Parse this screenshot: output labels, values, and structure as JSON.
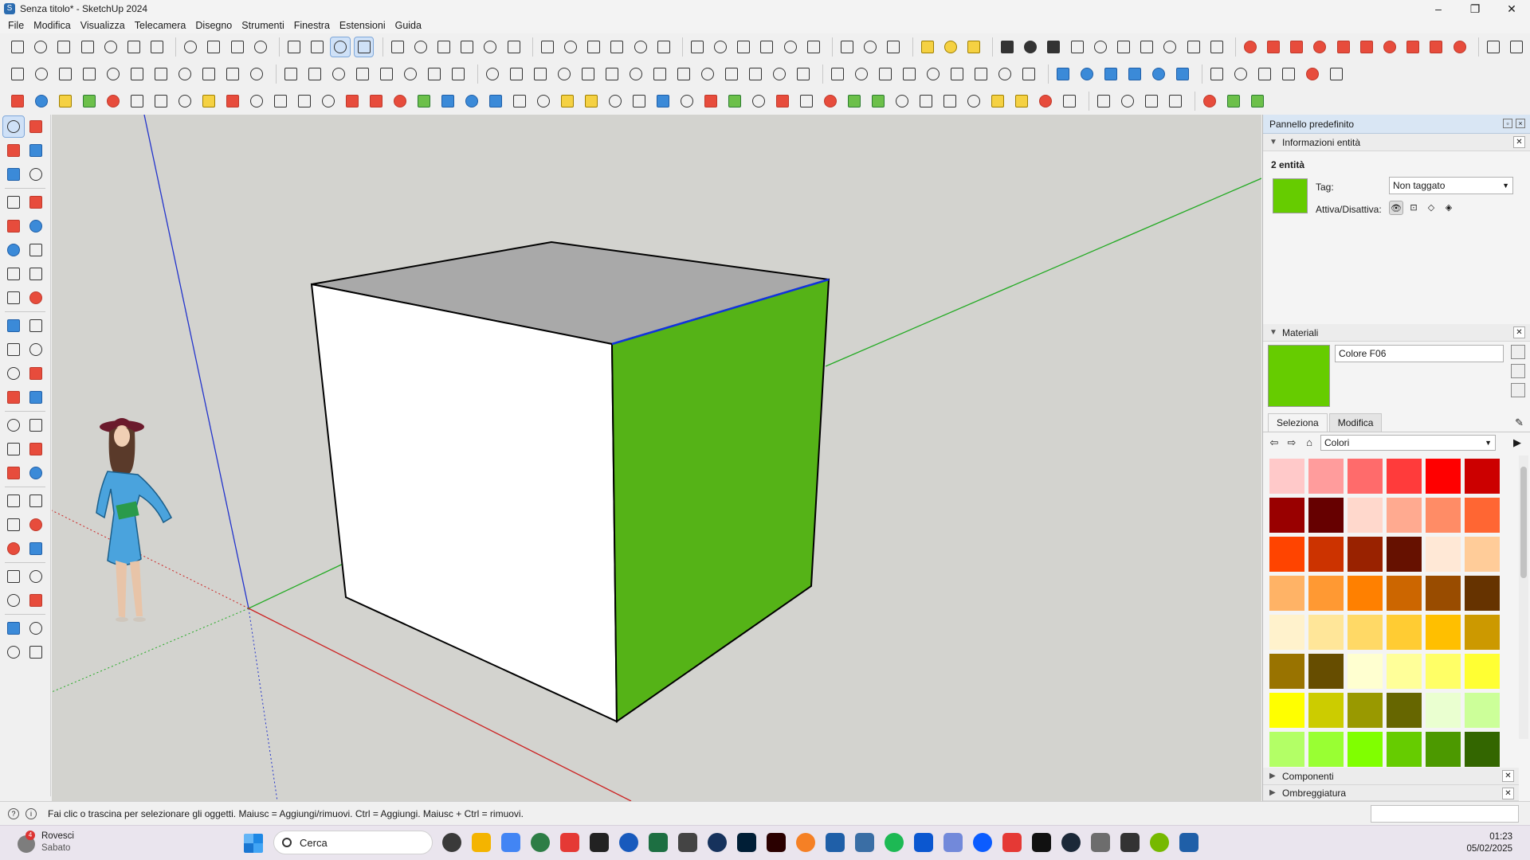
{
  "window": {
    "title": "Senza titolo* - SketchUp 2024",
    "controls": [
      "–",
      "❐",
      "✕"
    ]
  },
  "menu": [
    "File",
    "Modifica",
    "Visualizza",
    "Telecamera",
    "Disegno",
    "Strumenti",
    "Finestra",
    "Estensioni",
    "Guida"
  ],
  "panel": {
    "title": "Pannello predefinito",
    "entity_info": {
      "header": "Informazioni entità",
      "count": "2 entità",
      "tag_label": "Tag:",
      "tag_value": "Non taggato",
      "toggle_label": "Attiva/Disattiva:",
      "material_color": "#66cc00"
    },
    "materials": {
      "header": "Materiali",
      "name": "Colore F06",
      "color": "#66cc00",
      "tabs": [
        "Seleziona",
        "Modifica"
      ],
      "active_tab": "Seleziona",
      "collection": "Colori",
      "swatches": [
        "#ffc9c9",
        "#ff9c9c",
        "#ff6b6b",
        "#ff3b3b",
        "#ff0000",
        "#cc0000",
        "#990000",
        "#660000",
        "#ffd8cc",
        "#ffaa90",
        "#ff8c66",
        "#ff6633",
        "#ff4400",
        "#cc3300",
        "#992200",
        "#661100",
        "#ffe8d6",
        "#ffcc99",
        "#ffb366",
        "#ff9933",
        "#ff8000",
        "#cc6600",
        "#994c00",
        "#663300",
        "#fff2cc",
        "#ffe699",
        "#ffd966",
        "#ffcc33",
        "#ffbf00",
        "#cc9900",
        "#997300",
        "#664d00",
        "#ffffd0",
        "#ffff99",
        "#ffff66",
        "#ffff33",
        "#ffff00",
        "#cccc00",
        "#999900",
        "#666600",
        "#eaffd0",
        "#ccff99",
        "#b3ff66",
        "#99ff33",
        "#80ff00",
        "#66cc00",
        "#4c9900",
        "#336600"
      ]
    },
    "components_header": "Componenti",
    "shadows_header": "Ombreggiatura"
  },
  "status": {
    "text": "Fai clic o trascina per selezionare gli oggetti. Maiusc = Aggiungi/rimuovi. Ctrl = Aggiungi. Maiusc + Ctrl = rimuovi."
  },
  "taskbar": {
    "weather_title": "Rovesci",
    "weather_sub": "Sabato",
    "weather_badge": "4",
    "search_placeholder": "Cerca",
    "time": "01:23",
    "date": "05/02/2025",
    "app_colors": [
      "#3a3a3a",
      "#f4b400",
      "#4285f4",
      "#2d7d46",
      "#e53935",
      "#222222",
      "#185abd",
      "#1d6f42",
      "#444444",
      "#16325c",
      "#001e36",
      "#2a0000",
      "#f58025",
      "#1f5fa8",
      "#3a6ea5",
      "#1db954",
      "#0b57d0",
      "#7289da",
      "#0b5cff",
      "#e53935",
      "#111111",
      "#1b2838",
      "#6d6d6d",
      "#333333",
      "#76b900",
      "#1f5fa8"
    ]
  }
}
